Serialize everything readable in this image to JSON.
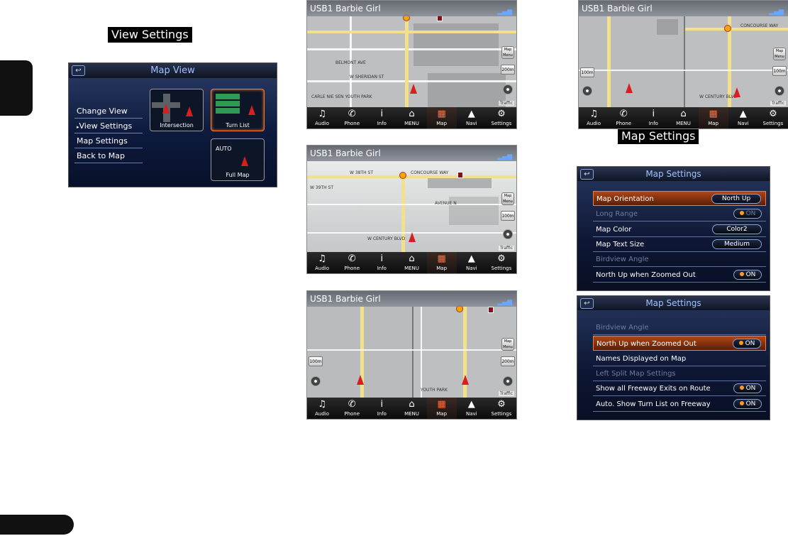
{
  "labels": {
    "view_settings": "View Settings",
    "map_settings": "Map Settings"
  },
  "map_view": {
    "title": "Map View",
    "menu": [
      "Change View",
      "View Settings",
      "Map Settings",
      "Back to Map"
    ],
    "selected_item": "View Settings",
    "tiles": [
      "Intersection",
      "Turn List",
      "Full Map"
    ],
    "selected_tile": "Turn List",
    "auto_label": "AUTO"
  },
  "map_screens": [
    {
      "title": "USB1 Barbie Girl",
      "streets": [
        "BELMONT AVE",
        "W SHERIDAN ST",
        "CARLE NIE SEN YOUTH PARK"
      ],
      "map_menu": "Map Menu",
      "scale": "200m",
      "traffic": "Traffic"
    },
    {
      "title": "USB1 Barbie Girl",
      "streets": [
        "W 39TH ST",
        "CONCOURSE WAY",
        "W 38TH ST",
        "AVENUE N",
        "W CENTURY BLVD"
      ],
      "map_menu": "Map Menu",
      "scale": "100m",
      "traffic": "Traffic"
    },
    {
      "title": "USB1 Barbie Girl",
      "streets": [
        "YOUTH PARK"
      ],
      "map_menu": "Map Menu",
      "scale_left": "100m",
      "scale": "200m",
      "traffic": "Traffic"
    },
    {
      "title": "USB1 Barbie Girl",
      "streets": [
        "CONCOURSE WAY",
        "W CENTURY BLVD"
      ],
      "map_menu": "Map Menu",
      "scale_left": "100m",
      "scale": "100m",
      "traffic": "Traffic"
    }
  ],
  "bottom_bar": [
    "Audio",
    "Phone",
    "Info",
    "MENU",
    "Map",
    "Navi",
    "Settings"
  ],
  "active_bottom": "Map",
  "map_settings_1": {
    "title": "Map Settings",
    "rows": [
      {
        "label": "Map Orientation",
        "value": "North Up",
        "kind": "value",
        "highlight": true
      },
      {
        "label": "Long Range",
        "value": "ON",
        "kind": "switch",
        "dim": true
      },
      {
        "label": "Map Color",
        "value": "Color2",
        "kind": "value"
      },
      {
        "label": "Map Text Size",
        "value": "Medium",
        "kind": "value"
      },
      {
        "label": "Birdview Angle",
        "value": "",
        "kind": "none",
        "dim": true
      },
      {
        "label": "North Up when Zoomed Out",
        "value": "ON",
        "kind": "switch"
      }
    ]
  },
  "map_settings_2": {
    "title": "Map Settings",
    "rows": [
      {
        "label": "Birdview Angle",
        "value": "",
        "kind": "none",
        "dim": true
      },
      {
        "label": "North Up when Zoomed Out",
        "value": "ON",
        "kind": "switch",
        "highlight": true
      },
      {
        "label": "Names Displayed on Map",
        "value": "",
        "kind": "none"
      },
      {
        "label": "Left Split Map Settings",
        "value": "",
        "kind": "none",
        "dim": true
      },
      {
        "label": "Show all Freeway Exits on Route",
        "value": "ON",
        "kind": "switch"
      },
      {
        "label": "Auto. Show Turn List on Freeway",
        "value": "ON",
        "kind": "switch"
      }
    ]
  },
  "colors": {
    "highlight": "#b04516",
    "panel": "#0e1b3e",
    "accent_text": "#9fc1ff",
    "route": "#f2e18a"
  }
}
